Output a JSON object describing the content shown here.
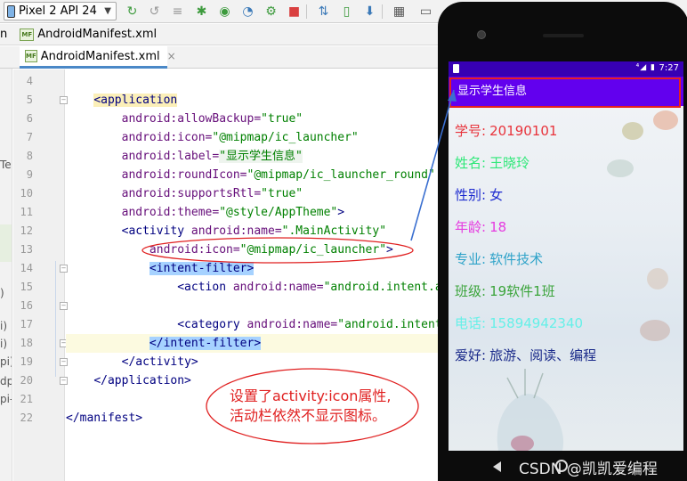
{
  "toolbar": {
    "device": "Pixel 2 API 24",
    "icons": [
      "run-icon",
      "rerun-icon",
      "apply-changes-icon",
      "debug-icon",
      "attach-debugger-icon",
      "profile-icon",
      "stop-icon",
      "sync-icon",
      "avd-manager-icon",
      "sdk-manager-icon",
      "layout-icon",
      "terminal-icon"
    ]
  },
  "breadcrumb": {
    "left": "n",
    "file": "AndroidManifest.xml"
  },
  "tab": {
    "label": "AndroidManifest.xml",
    "close": "×",
    "icon_text": "MF"
  },
  "left_strip": [
    "Te",
    ")",
    "i)",
    "pi)",
    "dp",
    "pi-"
  ],
  "editor": {
    "lines": [
      {
        "n": "4"
      },
      {
        "n": "5"
      },
      {
        "n": "6"
      },
      {
        "n": "7"
      },
      {
        "n": "8"
      },
      {
        "n": "9"
      },
      {
        "n": "10"
      },
      {
        "n": "11"
      },
      {
        "n": "12"
      },
      {
        "n": "13"
      },
      {
        "n": "14"
      },
      {
        "n": "15"
      },
      {
        "n": "16"
      },
      {
        "n": "17"
      },
      {
        "n": "18"
      },
      {
        "n": "19"
      },
      {
        "n": "20"
      },
      {
        "n": "21"
      },
      {
        "n": "22"
      }
    ],
    "code": {
      "application_open": "<application",
      "allowBackup_attr": "android:allowBackup=",
      "allowBackup_val": "\"true\"",
      "icon_attr": "android:icon=",
      "icon_val": "\"@mipmap/ic_launcher\"",
      "label_attr": "android:label=",
      "label_val": "\"显示学生信息\"",
      "roundIcon_attr": "android:roundIcon=",
      "roundIcon_val": "\"@mipmap/ic_launcher_round\"",
      "supportsRtl_attr": "android:supportsRtl=",
      "supportsRtl_val": "\"true\"",
      "theme_attr": "android:theme=",
      "theme_val": "\"@style/AppTheme\"",
      "theme_close": ">",
      "activity_open": "<activity",
      "activity_name_attr": " android:name=",
      "activity_name_val": "\".MainActivity\"",
      "activity_icon_attr": "android:icon=",
      "activity_icon_val": "\"@mipmap/ic_launcher\"",
      "activity_icon_close": ">",
      "intent_filter_open": "<intent-filter>",
      "action_open": "<action",
      "action_attr": " android:name=",
      "action_val": "\"android.intent.action.MAIN\" />",
      "category_open": "<category",
      "category_attr": " android:name=",
      "category_val": "\"android.intent.category.LAUNCHER\" />",
      "intent_filter_close": "</intent-filter>",
      "activity_close": "</activity>",
      "application_close": "</application>",
      "manifest_close": "</manifest>"
    }
  },
  "phone": {
    "status_time": "7:27",
    "status_icons": "⁴◢ ▮",
    "title": "显示学生信息",
    "fields": [
      {
        "label": "学号:",
        "value": "20190101",
        "color": "#e8333b"
      },
      {
        "label": "姓名:",
        "value": "王晓玲",
        "color": "#2ee878"
      },
      {
        "label": "性别:",
        "value": "女",
        "color": "#1d2bd0"
      },
      {
        "label": "年龄:",
        "value": "18",
        "color": "#e63be0"
      },
      {
        "label": "专业:",
        "value": "软件技术",
        "color": "#2fa3c9"
      },
      {
        "label": "班级:",
        "value": "19软件1班",
        "color": "#3aa43a"
      },
      {
        "label": "电话:",
        "value": "15894942340",
        "color": "#66f0e8"
      },
      {
        "label": "爱好:",
        "value": "旅游、阅读、编程",
        "color": "#1a2a8a"
      }
    ],
    "watermark": "CSDN @凯凯爱编程"
  },
  "annotation": {
    "callout_line1": "设置了activity:icon属性,",
    "callout_line2": "活动栏依然不显示图标。",
    "color": "#e02020"
  }
}
